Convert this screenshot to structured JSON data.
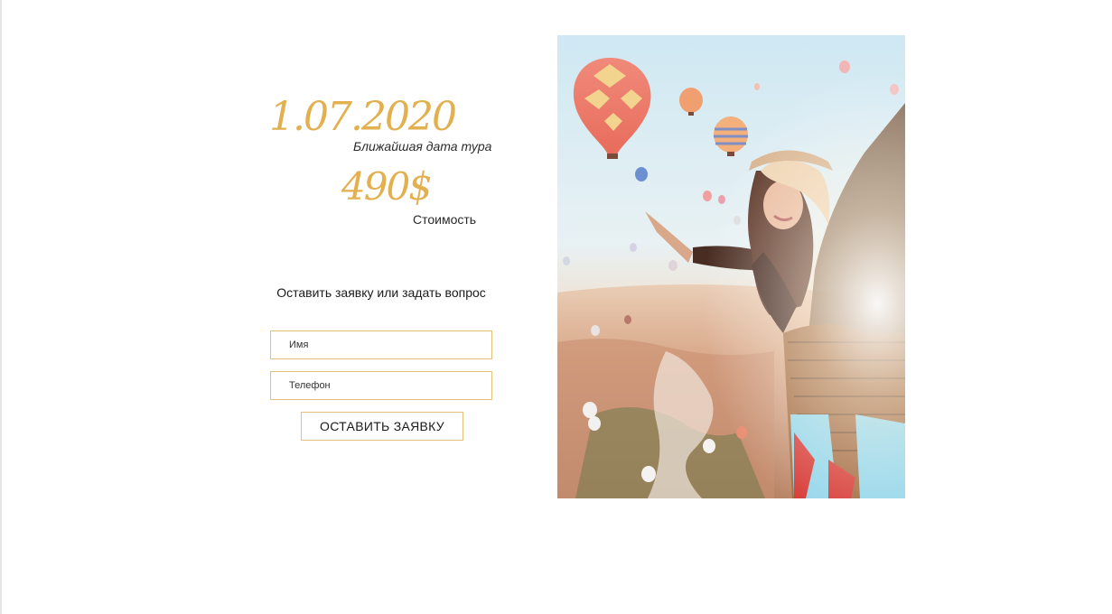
{
  "tour": {
    "date": "1.07.2020",
    "date_caption": "Ближайшая дата тура",
    "price": "490$",
    "price_caption": "Стоимость"
  },
  "form": {
    "title": "Оставить заявку или задать вопрос",
    "name_placeholder": "Имя",
    "phone_placeholder": "Телефон",
    "submit_label": "ОСТАВИТЬ ЗАЯВКУ"
  },
  "colors": {
    "accent": "#e2b04e",
    "border": "#e2c27a",
    "text": "#1a1a1a"
  },
  "image": {
    "subject": "hot-air-balloons-photo"
  }
}
